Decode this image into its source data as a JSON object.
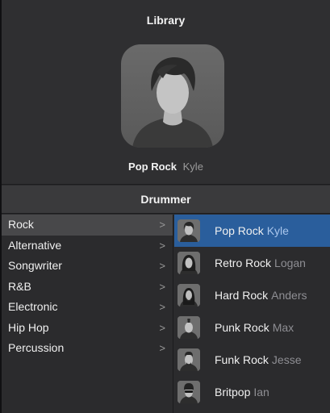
{
  "library": {
    "title": "Library",
    "selected_preset": "Pop Rock",
    "selected_drummer": "Kyle"
  },
  "section_title": "Drummer",
  "genres": [
    {
      "label": "Rock",
      "selected": true
    },
    {
      "label": "Alternative",
      "selected": false
    },
    {
      "label": "Songwriter",
      "selected": false
    },
    {
      "label": "R&B",
      "selected": false
    },
    {
      "label": "Electronic",
      "selected": false
    },
    {
      "label": "Hip Hop",
      "selected": false
    },
    {
      "label": "Percussion",
      "selected": false
    }
  ],
  "genre_chevron": ">",
  "drummers": [
    {
      "style": "Pop Rock",
      "name": "Kyle",
      "selected": true,
      "icon": "drummer-kyle-icon"
    },
    {
      "style": "Retro Rock",
      "name": "Logan",
      "selected": false,
      "icon": "drummer-logan-icon"
    },
    {
      "style": "Hard Rock",
      "name": "Anders",
      "selected": false,
      "icon": "drummer-anders-icon"
    },
    {
      "style": "Punk Rock",
      "name": "Max",
      "selected": false,
      "icon": "drummer-max-icon"
    },
    {
      "style": "Funk Rock",
      "name": "Jesse",
      "selected": false,
      "icon": "drummer-jesse-icon"
    },
    {
      "style": "Britpop",
      "name": "Ian",
      "selected": false,
      "icon": "drummer-ian-icon"
    }
  ],
  "colors": {
    "selection_blue": "#2a5e9c",
    "genre_selected": "#48484a",
    "background": "#2b2b2d"
  }
}
